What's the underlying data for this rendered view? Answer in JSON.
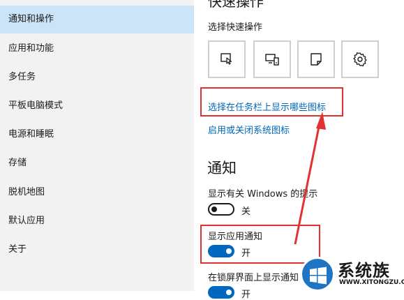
{
  "sidebar": {
    "items": [
      {
        "label": "通知和操作",
        "selected": true
      },
      {
        "label": "应用和功能",
        "selected": false
      },
      {
        "label": "多任务",
        "selected": false
      },
      {
        "label": "平板电脑模式",
        "selected": false
      },
      {
        "label": "电源和睡眠",
        "selected": false
      },
      {
        "label": "存储",
        "selected": false
      },
      {
        "label": "脱机地图",
        "selected": false
      },
      {
        "label": "默认应用",
        "selected": false
      },
      {
        "label": "关于",
        "selected": false
      }
    ]
  },
  "main": {
    "top_heading_partial": "快速操作",
    "choose_quick_actions": "选择快速操作",
    "quick_action_tiles": [
      {
        "icon": "tablet-mode-icon"
      },
      {
        "icon": "connect-icon"
      },
      {
        "icon": "note-icon"
      },
      {
        "icon": "settings-icon"
      }
    ],
    "link_taskbar_icons": "选择在任务栏上显示哪些图标",
    "link_system_icons": "启用或关闭系统图标",
    "notifications_heading": "通知",
    "windows_tips": {
      "label": "显示有关 Windows 的提示",
      "state_label": "关",
      "on": false
    },
    "app_notifications": {
      "label": "显示应用通知",
      "state_label": "开",
      "on": true
    },
    "lock_screen": {
      "label": "在锁屏界面上显示通知",
      "state_label": "开",
      "on": true
    }
  },
  "watermark": {
    "title": "系统族",
    "url": "WWW.XITONGZU.COM"
  },
  "colors": {
    "sidebar_bg": "#f2f2f2",
    "selected_bg": "#cce4f7",
    "link": "#0067b8",
    "toggle_on": "#0067c0",
    "annotation_red": "#e33131"
  }
}
